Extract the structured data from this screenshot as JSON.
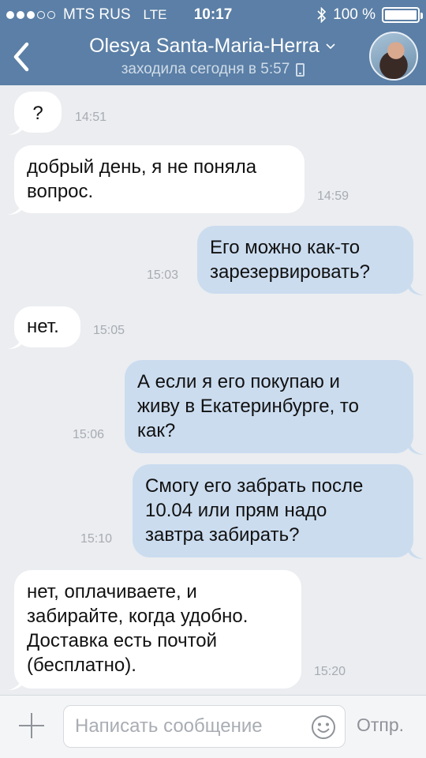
{
  "statusbar": {
    "carrier": "MTS RUS",
    "network": "LTE",
    "time": "10:17",
    "battery": "100 %",
    "battery_level": 1.0
  },
  "header": {
    "title": "Olesya Santa-Maria-Herra",
    "subtitle": "заходила сегодня в 5:57",
    "back_icon": "chevron-left-icon",
    "avatar_icon": "user-avatar"
  },
  "messages": [
    {
      "dir": "in",
      "text": "?",
      "time": "14:51"
    },
    {
      "dir": "in",
      "text": "добрый день, я не поняла\nвопрос.",
      "time": "14:59"
    },
    {
      "dir": "out",
      "text": "Его можно как-то\nзарезервировать?",
      "time": "15:03"
    },
    {
      "dir": "in",
      "text": "нет.",
      "time": "15:05"
    },
    {
      "dir": "out",
      "text": "А если я его покупаю и\nживу в Екатеринбурге, то\nкак?",
      "time": "15:06"
    },
    {
      "dir": "out",
      "text": "Смогу его забрать после\n10.04 или прям надо\nзавтра забирать?",
      "time": "15:10"
    },
    {
      "dir": "in",
      "text": "нет, оплачиваете, и\nзабирайте, когда удобно.\nДоставка есть почтой\n(бесплатно).",
      "time": "15:20"
    }
  ],
  "input": {
    "placeholder": "Написать сообщение",
    "value": "",
    "send_label": "Отпр.",
    "attach_icon": "plus-icon",
    "emoji_icon": "smile-icon"
  },
  "colors": {
    "header_bg": "#5b7fa6",
    "incoming_bubble": "#ffffff",
    "outgoing_bubble": "#cbdcef",
    "chat_bg": "#ebedf0"
  }
}
